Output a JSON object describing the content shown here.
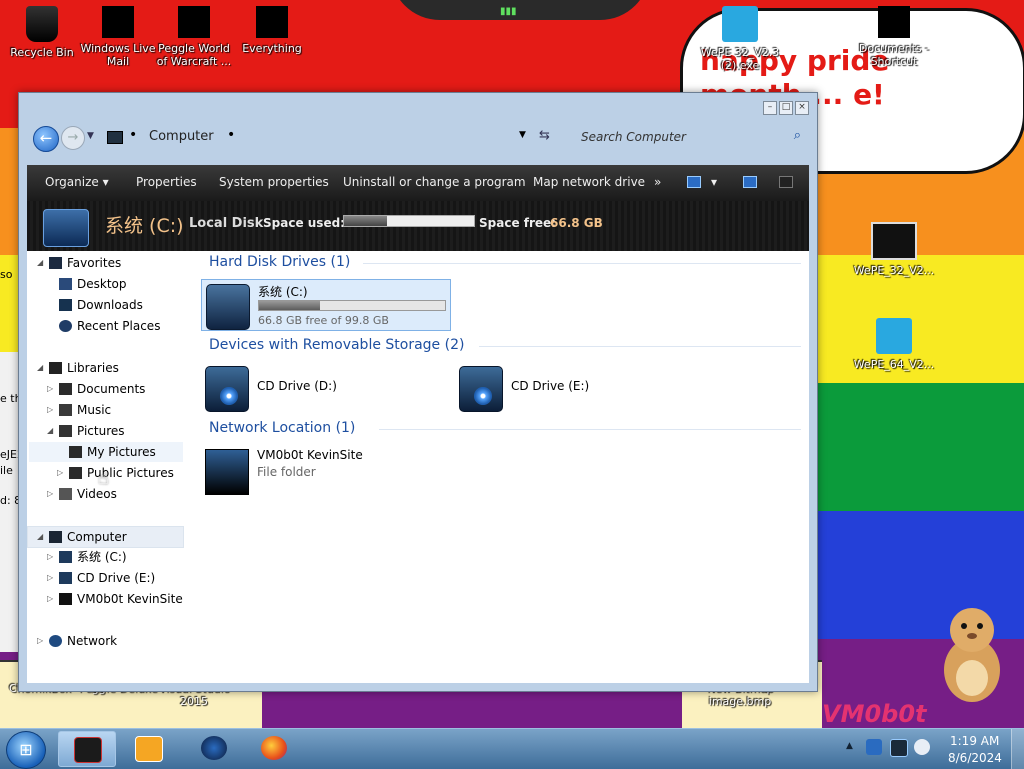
{
  "wallpaper": {
    "speech_text": "happy pride month ... e!",
    "corner_text": "VM0b0t"
  },
  "desktop_icons": {
    "recycle_bin": "Recycle Bin",
    "windows_live_mail": "Windows Live Mail",
    "peggle_world_of_warcraft": "Peggle World of Warcraft ...",
    "everything": "Everything",
    "wepe32_exe": "WePE 32_V2.3 (2).exe",
    "documents_shortcut": "Documents - Shortcut",
    "wepe32_v2": "WePE_32_V2...",
    "wepe64_v2": "WePE_64_V2...",
    "chomikbox": "ChomikBox",
    "peggle_deluxe": "Peggle Deluxe",
    "visual_studio": "Visual Studio 2015",
    "new_bitmap": "New Bitmap image.bmp"
  },
  "peek_window": {
    "lines": [
      "so",
      "e th",
      "eJE2",
      "ile",
      "d: 8"
    ]
  },
  "window": {
    "controls": {
      "minimize": "–",
      "maximize": "□",
      "close": "×"
    },
    "address": {
      "location": "Computer",
      "dot": "•"
    },
    "search": {
      "placeholder": "Search Computer"
    },
    "toolbar": {
      "organize": "Organize ▾",
      "properties": "Properties",
      "system_properties": "System properties",
      "uninstall": "Uninstall or change a program",
      "map_drive": "Map network drive",
      "more": "»",
      "view_drop": "▾"
    },
    "details": {
      "name": "系统 (C:)",
      "type": "Local Disk",
      "used_label": "Space used:",
      "used_fraction": 0.33,
      "free_label": "Space free:",
      "free_value": "66.8 GB"
    },
    "nav": {
      "favorites": "Favorites",
      "desktop": "Desktop",
      "downloads": "Downloads",
      "recent_places": "Recent Places",
      "libraries": "Libraries",
      "documents": "Documents",
      "music": "Music",
      "pictures": "Pictures",
      "my_pictures": "My Pictures",
      "public_pictures": "Public Pictures",
      "videos": "Videos",
      "computer": "Computer",
      "drive_c": "系统 (C:)",
      "cd_drive_e": "CD Drive (E:)",
      "vm_site": "VM0b0t KevinSite",
      "network": "Network"
    },
    "groups": {
      "hard_disk": "Hard Disk Drives (1)",
      "removable": "Devices with Removable Storage (2)",
      "network": "Network Location (1)"
    },
    "items": {
      "drive_c": {
        "name": "系统 (C:)",
        "free_text": "66.8 GB free of 99.8 GB",
        "used_fraction": 0.33
      },
      "cd_d": {
        "name": "CD Drive (D:)"
      },
      "cd_e": {
        "name": "CD Drive (E:)"
      },
      "net": {
        "name": "VM0b0t KevinSite",
        "sub": "File folder"
      }
    }
  },
  "taskbar": {
    "start_glyph": "⊞",
    "time": "1:19 AM",
    "date": "8/6/2024"
  },
  "colors": {
    "accent": "#1e4fa0",
    "toolbar_bg": "#1a1a1a",
    "gold": "#f3c28a"
  }
}
